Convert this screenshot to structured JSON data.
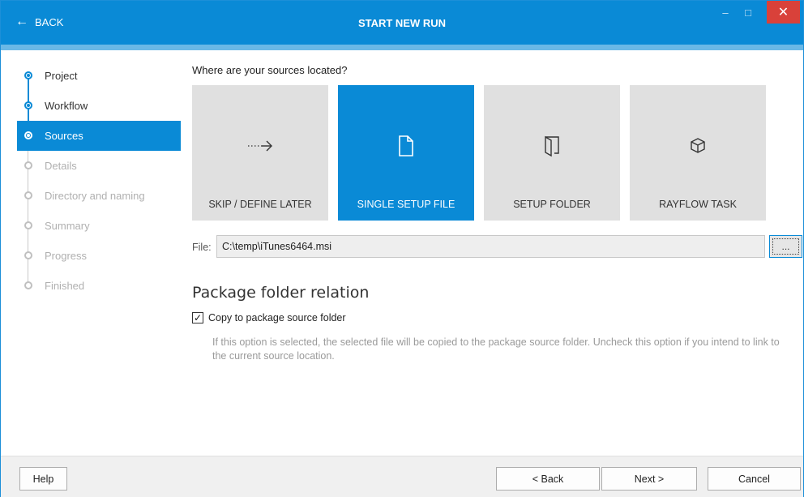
{
  "titlebar": {
    "back_label": "BACK",
    "title": "START NEW RUN",
    "minimize_glyph": "–",
    "maximize_glyph": "□",
    "close_glyph": "✕"
  },
  "sidebar": {
    "items": [
      {
        "label": "Project",
        "state": "done"
      },
      {
        "label": "Workflow",
        "state": "done"
      },
      {
        "label": "Sources",
        "state": "active"
      },
      {
        "label": "Details",
        "state": "disabled"
      },
      {
        "label": "Directory and naming",
        "state": "disabled"
      },
      {
        "label": "Summary",
        "state": "disabled"
      },
      {
        "label": "Progress",
        "state": "disabled"
      },
      {
        "label": "Finished",
        "state": "disabled"
      }
    ]
  },
  "main": {
    "question": "Where are your sources located?",
    "tiles": [
      {
        "label": "SKIP / DEFINE LATER",
        "icon": "dotted-arrow-right-icon",
        "selected": false
      },
      {
        "label": "SINGLE SETUP FILE",
        "icon": "file-icon",
        "selected": true
      },
      {
        "label": "SETUP FOLDER",
        "icon": "folder-icon",
        "selected": false
      },
      {
        "label": "RAYFLOW TASK",
        "icon": "cube-icon",
        "selected": false
      }
    ],
    "file": {
      "label": "File:",
      "value": "C:\\temp\\iTunes6464.msi",
      "browse_label": "..."
    },
    "section_heading": "Package folder relation",
    "copy_checkbox": {
      "label": "Copy to package source folder",
      "checked": true
    },
    "hint": "If this option is selected, the selected file will be copied to the package source folder. Uncheck this option if you intend to link to the current source location."
  },
  "footer": {
    "help_label": "Help",
    "back_label": "< Back",
    "next_label": "Next >",
    "cancel_label": "Cancel"
  },
  "colors": {
    "accent": "#0a8ad6",
    "accent_light": "#6ab8e6",
    "tile_bg": "#e0e0e0",
    "close_red": "#d9413a",
    "disabled_text": "#b0b0b0"
  }
}
